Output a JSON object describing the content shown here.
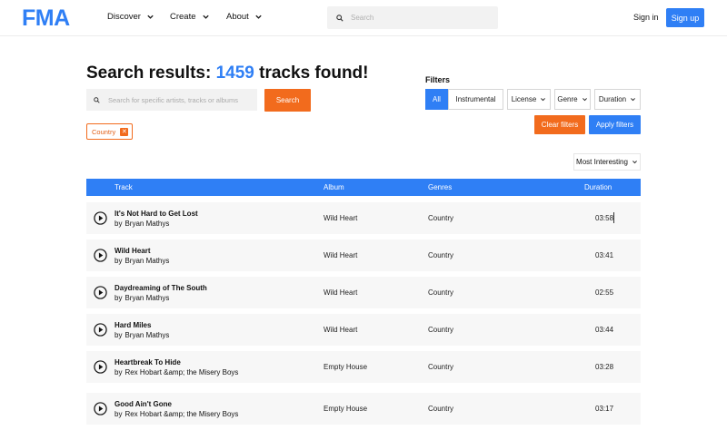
{
  "header": {
    "logo_text": "FMA",
    "nav": [
      {
        "label": "Discover"
      },
      {
        "label": "Create"
      },
      {
        "label": "About"
      }
    ],
    "search_placeholder": "Search",
    "signin_label": "Sign in",
    "signup_label": "Sign up"
  },
  "results": {
    "title_prefix": "Search results:",
    "count": "1459",
    "title_suffix": "tracks found!",
    "query_placeholder": "Search for specific artists, tracks or albums",
    "search_button": "Search",
    "active_chip": "Country",
    "chip_remove": "✕"
  },
  "filters": {
    "label": "Filters",
    "buttons": [
      {
        "label": "All",
        "active": true
      },
      {
        "label": "Instrumental",
        "active": false
      },
      {
        "label": "License",
        "dropdown": true
      },
      {
        "label": "Genre",
        "dropdown": true
      },
      {
        "label": "Duration",
        "dropdown": true
      }
    ],
    "clear_label": "Clear filters",
    "apply_label": "Apply filters",
    "sort_label": "Most Interesting"
  },
  "table": {
    "columns": [
      "Track",
      "Album",
      "Genres",
      "Duration"
    ],
    "rows": [
      {
        "track": "It's Not Hard to Get Lost",
        "by": "by",
        "artist": "Bryan Mathys",
        "album": "Wild Heart",
        "genre": "Country",
        "duration": "03:58"
      },
      {
        "track": "Wild Heart",
        "by": "by",
        "artist": "Bryan Mathys",
        "album": "Wild Heart",
        "genre": "Country",
        "duration": "03:41"
      },
      {
        "track": "Daydreaming of The South",
        "by": "by",
        "artist": "Bryan Mathys",
        "album": "Wild Heart",
        "genre": "Country",
        "duration": "02:55"
      },
      {
        "track": "Hard Miles",
        "by": "by",
        "artist": "Bryan Mathys",
        "album": "Wild Heart",
        "genre": "Country",
        "duration": "03:44"
      },
      {
        "track": "Heartbreak To Hide",
        "by": "by",
        "artist": "Rex Hobart &amp; the Misery Boys",
        "album": "Empty House",
        "genre": "Country",
        "duration": "03:28"
      },
      {
        "track": "Good Ain't Gone",
        "by": "by",
        "artist": "Rex Hobart &amp; the Misery Boys",
        "album": "Empty House",
        "genre": "Country",
        "duration": "03:17"
      }
    ]
  },
  "colors": {
    "accent_blue": "#2f7ff5",
    "accent_orange": "#f26b1d",
    "row_bg": "#f7f7f7"
  }
}
